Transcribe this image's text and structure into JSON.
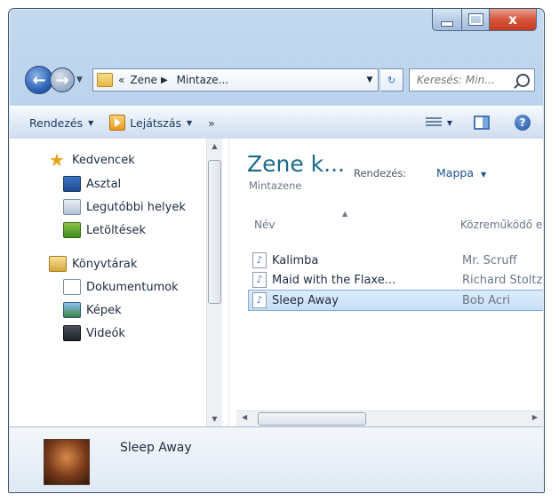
{
  "window": {
    "close_glyph": "x"
  },
  "nav": {
    "back_glyph": "←",
    "forward_glyph": "→",
    "breadcrumb": [
      "«",
      "Zene",
      "Mintaze..."
    ],
    "search_placeholder": "Keresés: Min..."
  },
  "commands": {
    "organize": "Rendezés",
    "play": "Lejátszás",
    "more": "»"
  },
  "sidebar": {
    "favorites": "Kedvencek",
    "items": [
      {
        "label": "Asztal",
        "icon": "desktop-icon"
      },
      {
        "label": "Legutóbbi helyek",
        "icon": "recent-places-icon"
      },
      {
        "label": "Letöltések",
        "icon": "downloads-icon"
      }
    ],
    "libraries": "Könyvtárak",
    "lib_items": [
      {
        "label": "Dokumentumok",
        "icon": "documents-icon"
      },
      {
        "label": "Képek",
        "icon": "pictures-icon"
      },
      {
        "label": "Videók",
        "icon": "videos-icon"
      }
    ]
  },
  "library": {
    "title": "Zene k...",
    "subtitle": "Mintazene",
    "arrange_label": "Rendezés:",
    "arrange_value": "Mappa"
  },
  "columns": {
    "name": "Név",
    "artist": "Közreműködő el"
  },
  "files": [
    {
      "name": "Kalimba",
      "artist": "Mr. Scruff",
      "selected": false
    },
    {
      "name": "Maid with the Flaxe...",
      "artist": "Richard Stoltzma",
      "selected": false
    },
    {
      "name": "Sleep Away",
      "artist": "Bob Acri",
      "selected": true
    }
  ],
  "details": {
    "title": "Sleep Away"
  },
  "colors": {
    "accent": "#1a6a8a",
    "selection": "#c6dff9",
    "frame": "#a9c6e6"
  }
}
